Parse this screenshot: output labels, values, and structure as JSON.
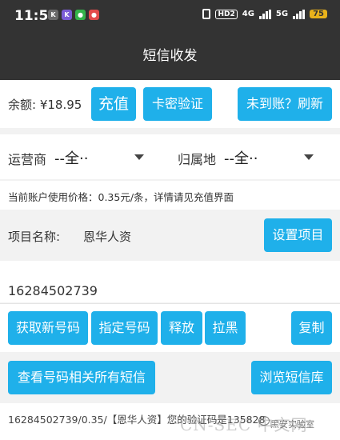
{
  "status_bar": {
    "time": "11:50",
    "apps": [
      {
        "icon": "k-app-icon",
        "glyph": "K",
        "color": "#6a6a6a"
      },
      {
        "icon": "k-purple-app-icon",
        "glyph": "K",
        "color": "#7b5cd6"
      },
      {
        "icon": "green-app-icon",
        "glyph": "●",
        "color": "#34b34a"
      },
      {
        "icon": "red-app-icon",
        "glyph": "●",
        "color": "#e24a4a"
      }
    ],
    "hd": "HD2",
    "network": "4G",
    "network2": "5G",
    "battery": "75"
  },
  "header": {
    "title": "短信收发"
  },
  "balance": {
    "label": "余额: ¥18.95",
    "recharge_button": "充值",
    "card_verify_button": "卡密验证",
    "refresh_button": "未到账？刷新"
  },
  "filters": {
    "carrier_label": "运营商",
    "carrier_value": "--全··",
    "region_label": "归属地",
    "region_value": "--全··"
  },
  "price_note": "当前账户使用价格：0.35元/条，详情请见充值界面",
  "project": {
    "label": "项目名称:",
    "value": "恩华人资",
    "set_button": "设置项目"
  },
  "phone_number": "16284502739",
  "actions": {
    "get_number": "获取新号码",
    "assign_number": "指定号码",
    "release": "释放",
    "blacklist": "拉黑",
    "copy": "复制"
  },
  "sms_actions": {
    "view_all": "查看号码相关所有短信",
    "browse_library": "浏览短信库"
  },
  "sms_message": "16284502739/0.35/【恩华人资】您的验证码是135828",
  "watermark": {
    "site": "CN-SEC 中文网",
    "wechat": "黑安实验室"
  },
  "colors": {
    "accent": "#1fb0ea",
    "header_bg": "#333333",
    "page_bg": "#f2f2f2"
  }
}
